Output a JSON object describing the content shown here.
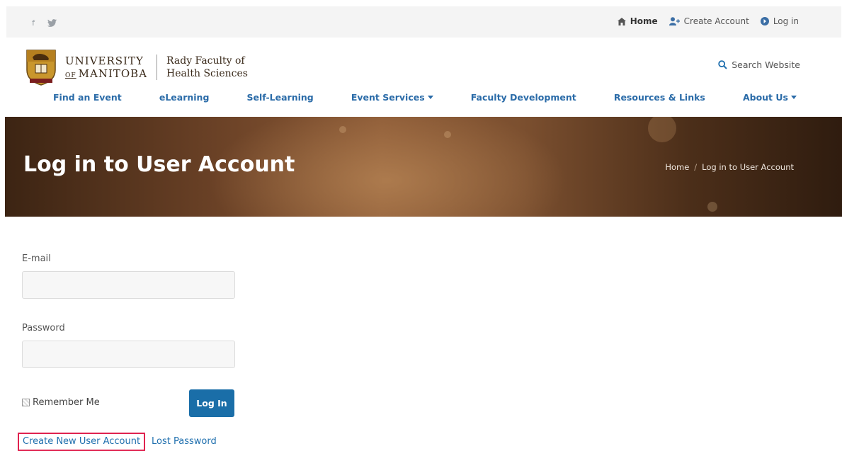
{
  "topbar": {
    "social": {
      "facebook_icon": "f",
      "twitter_icon": "t"
    },
    "home": "Home",
    "create_account": "Create Account",
    "log_in": "Log in"
  },
  "logo": {
    "university_line1": "UNIVERSITY",
    "university_of": "OF",
    "university_line2": "MANITOBA",
    "faculty_line1": "Rady Faculty of",
    "faculty_line2": "Health Sciences"
  },
  "search": {
    "label": "Search Website"
  },
  "nav": {
    "items": [
      {
        "label": "Find an Event",
        "dropdown": false
      },
      {
        "label": "eLearning",
        "dropdown": false
      },
      {
        "label": "Self-Learning",
        "dropdown": false
      },
      {
        "label": "Event Services",
        "dropdown": true
      },
      {
        "label": "Faculty Development",
        "dropdown": false
      },
      {
        "label": "Resources & Links",
        "dropdown": false
      },
      {
        "label": "About Us",
        "dropdown": true
      }
    ]
  },
  "hero": {
    "title": "Log in to User Account",
    "breadcrumb": {
      "home": "Home",
      "separator": "/",
      "current": "Log in to User Account"
    }
  },
  "form": {
    "email_label": "E-mail",
    "email_value": "",
    "password_label": "Password",
    "password_value": "",
    "remember_label": "Remember Me",
    "login_button": "Log In",
    "create_account_link": "Create New User Account",
    "lost_password_link": "Lost Password"
  },
  "colors": {
    "link": "#1f6fae",
    "nav": "#2a6ba8",
    "button": "#1a6ea8",
    "highlight": "#e0224f",
    "hero_brown": "#6a4126"
  }
}
